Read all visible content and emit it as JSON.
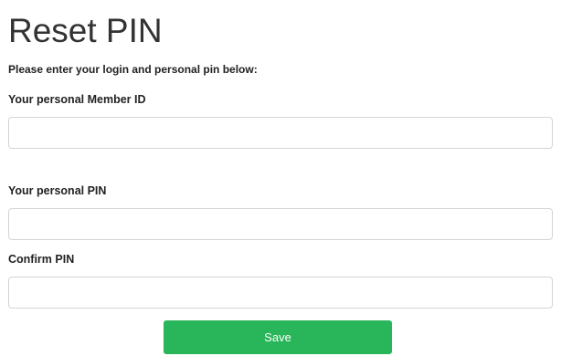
{
  "page": {
    "title": "Reset PIN",
    "intro": "Please enter your login and personal pin below:"
  },
  "form": {
    "member_id": {
      "label": "Your personal Member ID",
      "value": "",
      "placeholder": ""
    },
    "pin": {
      "label": "Your personal PIN",
      "value": "",
      "placeholder": ""
    },
    "confirm_pin": {
      "label": "Confirm PIN",
      "value": "",
      "placeholder": ""
    },
    "save_label": "Save"
  },
  "colors": {
    "button_bg": "#29b559",
    "button_text": "#ffffff",
    "input_border": "#d4d4d4",
    "text": "#333333"
  }
}
